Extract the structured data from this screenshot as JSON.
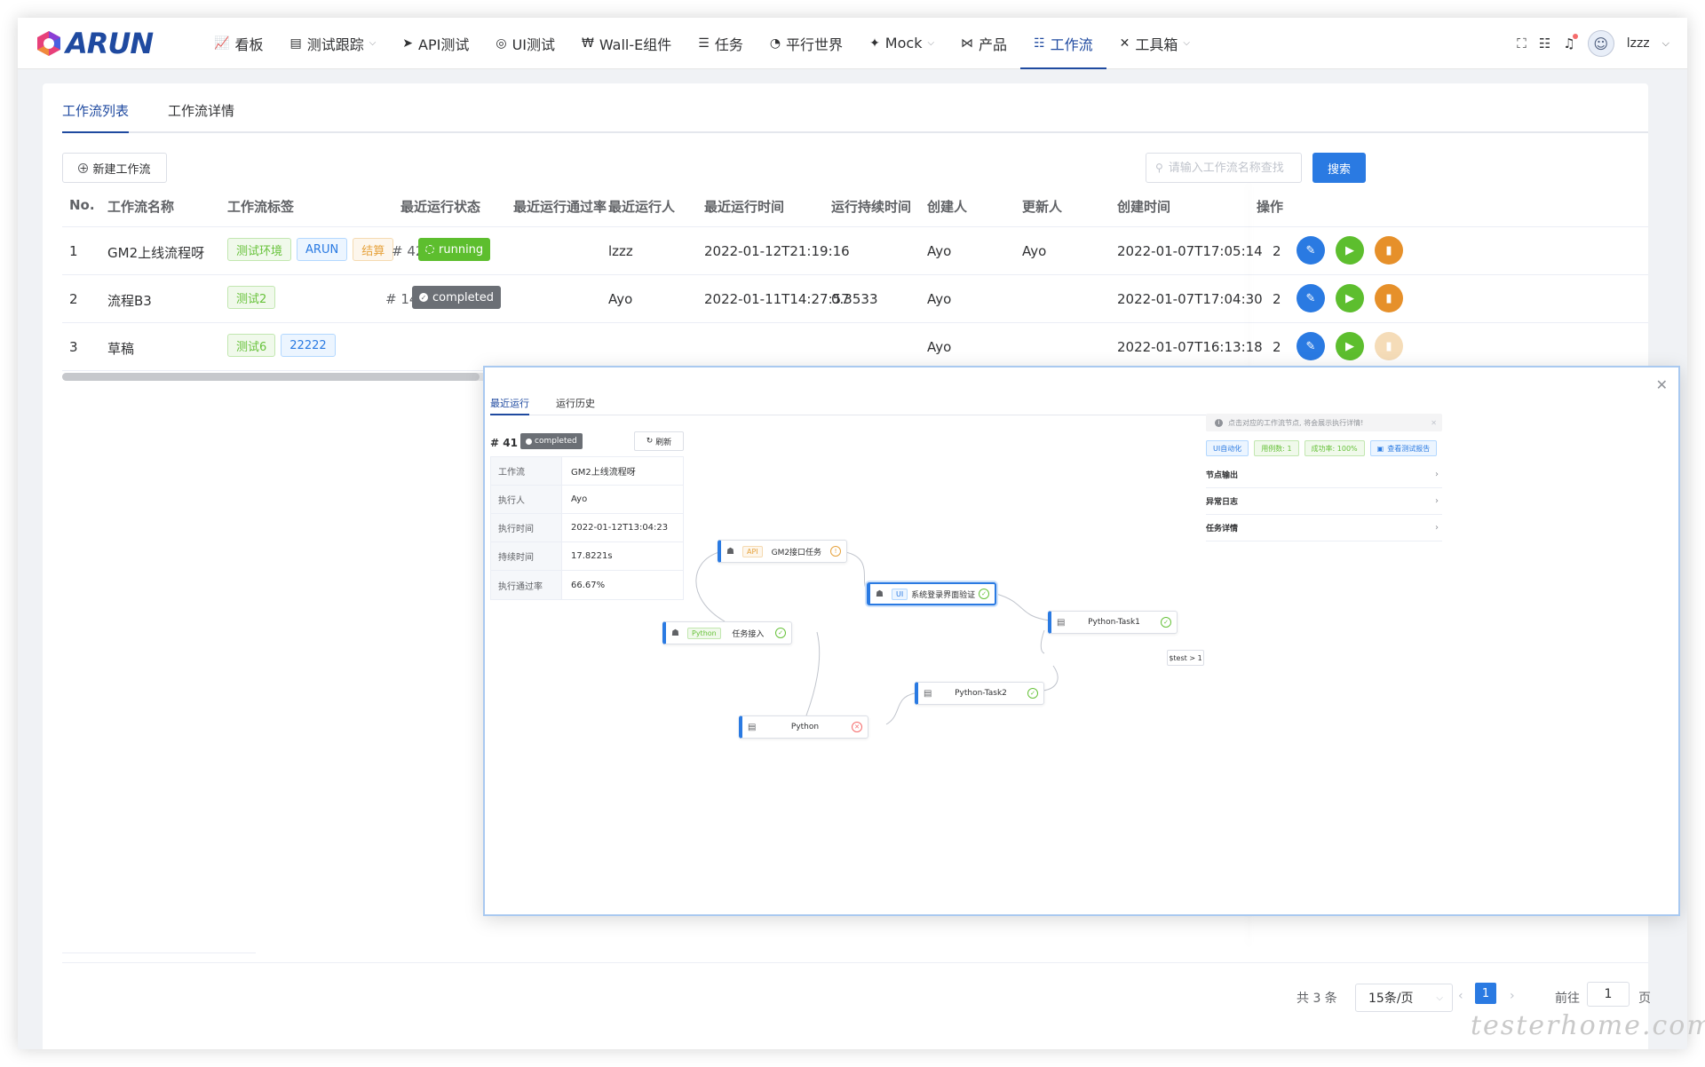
{
  "brand": {
    "logo_text": "ARUN",
    "colors": {
      "primary": "#1f4aa0",
      "accent": "#2a7ae2",
      "success": "#5dbe2e",
      "warning": "#e6902a"
    }
  },
  "nav": {
    "items": [
      {
        "label": "看板",
        "icon": "chart-line-icon",
        "glyph": "📈"
      },
      {
        "label": "测试跟踪",
        "icon": "file-icon",
        "glyph": "▤"
      },
      {
        "label": "API测试",
        "icon": "paper-plane-icon",
        "glyph": "➤"
      },
      {
        "label": "UI测试",
        "icon": "compass-icon",
        "glyph": "◎"
      },
      {
        "label": "Wall-E组件",
        "icon": "won-icon",
        "glyph": "₩"
      },
      {
        "label": "任务",
        "icon": "task-list-icon",
        "glyph": "☰"
      },
      {
        "label": "平行世界",
        "icon": "broadcast-icon",
        "glyph": "◔"
      },
      {
        "label": "Mock",
        "icon": "magic-wand-icon",
        "glyph": "✦"
      },
      {
        "label": "产品",
        "icon": "nodes-icon",
        "glyph": "⋈"
      },
      {
        "label": "工作流",
        "icon": "sliders-icon",
        "glyph": "☷"
      },
      {
        "label": "工具箱",
        "icon": "tools-icon",
        "glyph": "✕"
      }
    ],
    "user_name": "lzzz"
  },
  "tabs": {
    "list": "工作流列表",
    "detail": "工作流详情"
  },
  "toolbar": {
    "new_button": "新建工作流",
    "search_placeholder": "请输入工作流名称查找",
    "search_button": "搜索"
  },
  "table": {
    "headers": {
      "no": "No.",
      "name": "工作流名称",
      "tags": "工作流标签",
      "status": "最近运行状态",
      "pass_rate": "最近运行通过率",
      "runner": "最近运行人",
      "run_time": "最近运行时间",
      "duration": "运行持续时间",
      "creator": "创建人",
      "updater": "更新人",
      "created_at": "创建时间",
      "ops": "操作"
    },
    "rows": [
      {
        "no": "1",
        "name": "GM2上线流程呀",
        "tags": [
          {
            "text": "测试环境"
          },
          {
            "text": "ARUN"
          },
          {
            "text": "结算"
          }
        ],
        "run_no": "# 42",
        "status": "running",
        "pass_rate": "",
        "runner": "lzzz",
        "run_time": "2022-01-12T21:19:16",
        "duration": "",
        "creator": "Ayo",
        "updater": "Ayo",
        "created_at": "2022-01-07T17:05:14",
        "trunc": "2"
      },
      {
        "no": "2",
        "name": "流程B3",
        "tags": [
          {
            "text": "测试2"
          }
        ],
        "run_no": "# 14",
        "status": "completed",
        "pass_rate": "",
        "runner": "Ayo",
        "run_time": "2022-01-11T14:27:57",
        "duration": "0.3533",
        "creator": "Ayo",
        "updater": "",
        "created_at": "2022-01-07T17:04:30",
        "trunc": "2"
      },
      {
        "no": "3",
        "name": "草稿",
        "tags": [
          {
            "text": "测试6"
          },
          {
            "text": "22222"
          }
        ],
        "run_no": "",
        "status": "",
        "pass_rate": "",
        "runner": "",
        "run_time": "",
        "duration": "",
        "creator": "Ayo",
        "updater": "",
        "created_at": "2022-01-07T16:13:18",
        "trunc": "2"
      }
    ]
  },
  "pagination": {
    "total": "共 3 条",
    "page_size": "15条/页",
    "current": "1",
    "goto_label": "前往",
    "goto_value": "1",
    "page_label": "页"
  },
  "modal": {
    "tabs": {
      "recent": "最近运行",
      "history": "运行历史"
    },
    "run_no": "# 41",
    "status": "completed",
    "refresh": "刷新",
    "info": [
      {
        "k": "工作流",
        "v": "GM2上线流程呀"
      },
      {
        "k": "执行人",
        "v": "Ayo"
      },
      {
        "k": "执行时间",
        "v": "2022-01-12T13:04:23"
      },
      {
        "k": "持续时间",
        "v": "17.8221s"
      },
      {
        "k": "执行通过率",
        "v": "66.67%"
      }
    ],
    "nodes": [
      {
        "type": "API",
        "name": "GM2接口任务",
        "state": "warn"
      },
      {
        "type": "UI",
        "name": "系统登录界面验证",
        "state": "ok"
      },
      {
        "type": "Python",
        "name": "任务接入",
        "state": "ok"
      },
      {
        "type": "",
        "name": "Python-Task1",
        "state": "ok"
      },
      {
        "type": "",
        "name": "Python-Task2",
        "state": "ok"
      },
      {
        "type": "",
        "name": "Python",
        "state": "err"
      }
    ],
    "edge_label": "$test > 1",
    "alert": "点击对应的工作流节点, 将会展示执行详情!",
    "detail_tags": {
      "type": "UI自动化",
      "cases": "用例数: 1",
      "rate": "成功率: 100%",
      "report": "查看测试报告"
    },
    "sections": {
      "output": "节点输出",
      "errors": "异常日志",
      "task": "任务详情"
    }
  },
  "watermark": "testerhome.com"
}
